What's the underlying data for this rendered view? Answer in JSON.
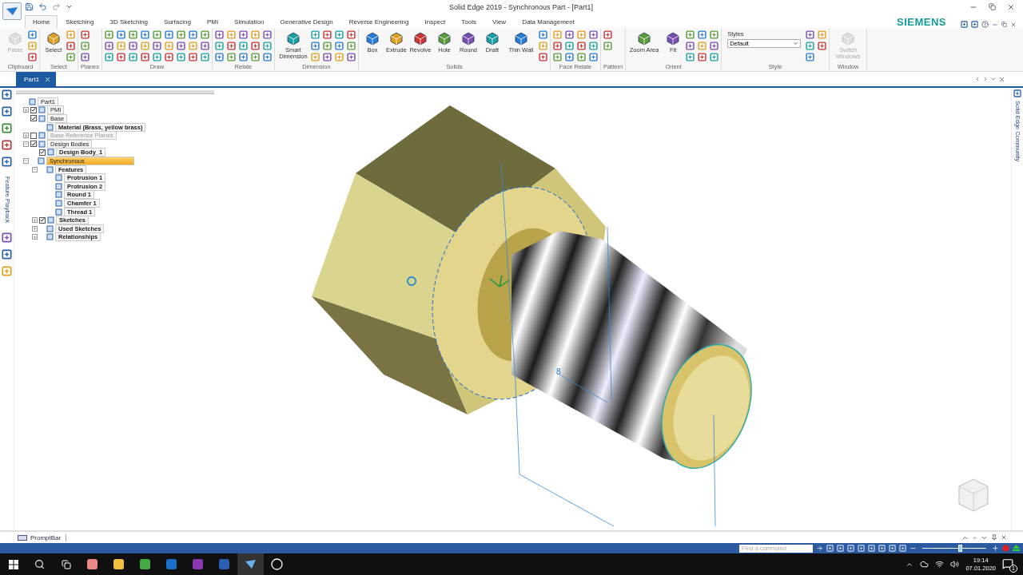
{
  "window": {
    "title": "Solid Edge 2019 - Synchronous Part - [Part1]",
    "brand": "SIEMENS"
  },
  "tabs": [
    {
      "label": "Home",
      "selected": true
    },
    {
      "label": "Sketching",
      "selected": false
    },
    {
      "label": "3D Sketching",
      "selected": false
    },
    {
      "label": "Surfacing",
      "selected": false
    },
    {
      "label": "PMI",
      "selected": false
    },
    {
      "label": "Simulation",
      "selected": false
    },
    {
      "label": "Generative Design",
      "selected": false
    },
    {
      "label": "Reverse Engineering",
      "selected": false
    },
    {
      "label": "Inspect",
      "selected": false
    },
    {
      "label": "Tools",
      "selected": false
    },
    {
      "label": "View",
      "selected": false
    },
    {
      "label": "Data Management",
      "selected": false
    }
  ],
  "ribbon": [
    {
      "label": "Clipboard",
      "buttons": [
        {
          "label": "Paste",
          "disabled": true
        }
      ]
    },
    {
      "label": "Select",
      "buttons": [
        {
          "label": "Select",
          "disabled": false
        }
      ]
    },
    {
      "label": "Planes"
    },
    {
      "label": "Draw"
    },
    {
      "label": "Relate"
    },
    {
      "label": "Dimension",
      "buttons": [
        {
          "label": "Smart Dimension",
          "disabled": false
        }
      ]
    },
    {
      "label": "Solids",
      "buttons": [
        {
          "label": "Box",
          "disabled": false
        },
        {
          "label": "Extrude",
          "disabled": false
        },
        {
          "label": "Revolve",
          "disabled": false
        },
        {
          "label": "Hole",
          "disabled": false
        },
        {
          "label": "Round",
          "disabled": false
        },
        {
          "label": "Draft",
          "disabled": false
        },
        {
          "label": "Thin Wall",
          "disabled": false
        }
      ]
    },
    {
      "label": "Face Relate"
    },
    {
      "label": "Pattern"
    },
    {
      "label": "Orient",
      "buttons": [
        {
          "label": "Zoom Area",
          "disabled": false
        },
        {
          "label": "Fit",
          "disabled": false
        }
      ]
    },
    {
      "label": "Style"
    },
    {
      "label": "Window",
      "buttons": [
        {
          "label": "Switch Windows",
          "disabled": true
        }
      ]
    }
  ],
  "style_picker": {
    "title": "Styles",
    "value": "Default"
  },
  "document_tab": {
    "label": "Part1"
  },
  "tree": [
    {
      "label": "Part1",
      "selected": false,
      "disabled": false,
      "children": [
        {
          "label": "PMI",
          "expanded": false,
          "checked": true,
          "selected": false,
          "disabled": false
        },
        {
          "label": "Base",
          "checked": true,
          "selected": false,
          "disabled": false,
          "children": [
            {
              "label": "Material (Brass, yellow brass)",
              "selected": false,
              "disabled": false
            }
          ]
        },
        {
          "label": "Base Reference Planes",
          "expanded": false,
          "checked": false,
          "selected": false,
          "disabled": true
        },
        {
          "label": "Design Bodies",
          "expanded": true,
          "checked": true,
          "selected": false,
          "disabled": false,
          "children": [
            {
              "label": "Design Body_1",
              "checked": true,
              "selected": false,
              "disabled": false
            }
          ]
        },
        {
          "label": "Synchronous",
          "expanded": true,
          "selected": true,
          "disabled": false,
          "children": [
            {
              "label": "Features",
              "expanded": true,
              "selected": false,
              "disabled": false,
              "children": [
                {
                  "label": "Protrusion 1",
                  "selected": false,
                  "disabled": false
                },
                {
                  "label": "Protrusion 2",
                  "selected": false,
                  "disabled": false
                },
                {
                  "label": "Round 1",
                  "selected": false,
                  "disabled": false
                },
                {
                  "label": "Chamfer 1",
                  "selected": false,
                  "disabled": false
                },
                {
                  "label": "Thread 1",
                  "selected": false,
                  "disabled": false
                }
              ]
            },
            {
              "label": "Sketches",
              "expanded": false,
              "checked": true,
              "selected": false,
              "disabled": false
            },
            {
              "label": "Used Sketches",
              "expanded": false,
              "selected": false,
              "disabled": false
            },
            {
              "label": "Relationships",
              "expanded": false,
              "selected": false,
              "disabled": false
            }
          ]
        }
      ]
    }
  ],
  "left_panel": {
    "label": "Feature Playback"
  },
  "right_panel": {
    "label": "Solid Edge Community"
  },
  "viewport": {
    "dimension_label": "8"
  },
  "prompt_bar": {
    "label": "PromptBar"
  },
  "status_bar": {
    "search": {
      "placeholder": "Find a command"
    },
    "zoom": {
      "level": 0.6
    }
  },
  "taskbar": {
    "time": "19:14",
    "date": "07.01.2020",
    "notifications": "1"
  }
}
